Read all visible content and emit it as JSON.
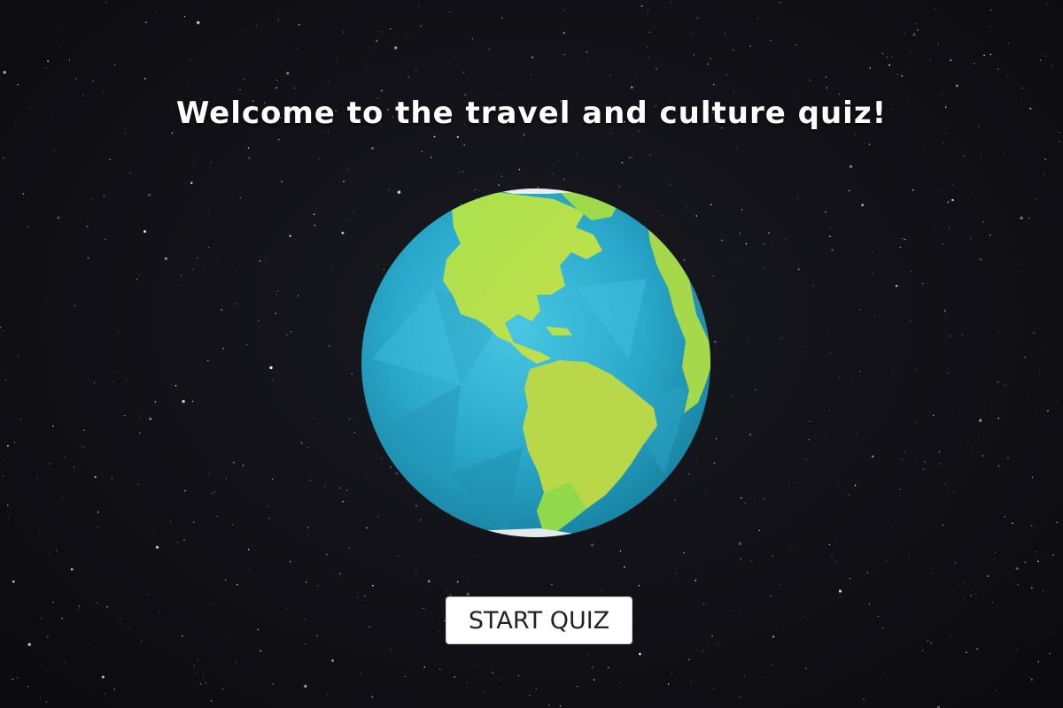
{
  "page": {
    "title": "Welcome to the travel and culture quiz!"
  },
  "globe": {
    "icon": "globe-icon",
    "colors": {
      "ocean": "#2fb4d3",
      "ocean_dark": "#1f93b3",
      "land": "#9ad64a",
      "land_light": "#c8e34f",
      "ice": "#e9f0f2"
    }
  },
  "actions": {
    "start_label": "START QUIZ"
  },
  "theme": {
    "background": "#0d0d10",
    "title_color": "#ffffff",
    "button_bg": "#ffffff",
    "button_text": "#222222"
  }
}
